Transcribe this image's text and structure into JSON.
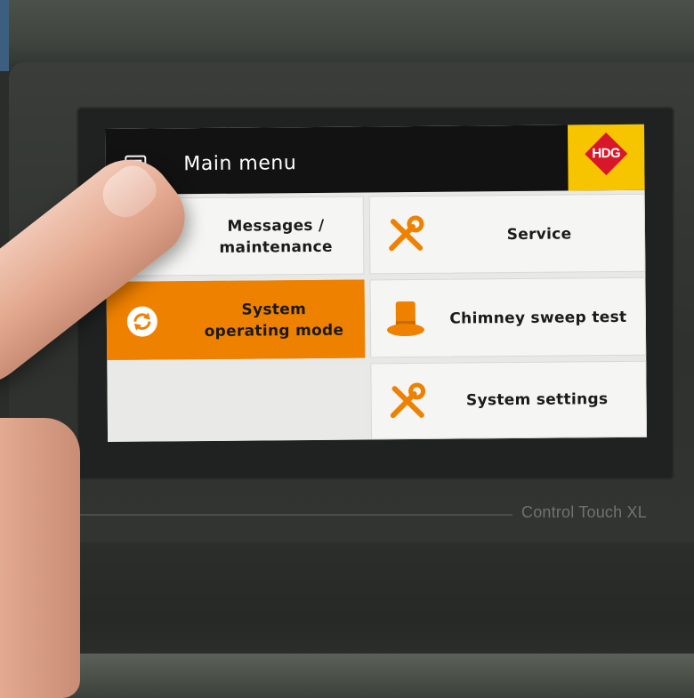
{
  "screen": {
    "title": "Main menu",
    "logo_text": "HDG",
    "tiles": [
      {
        "label_line1": "Messages /",
        "label_line2": "maintenance",
        "icon": "warning-icon",
        "active": false
      },
      {
        "label": "Service",
        "icon": "tools-icon",
        "active": false
      },
      {
        "label_line1": "System",
        "label_line2": "operating mode",
        "icon": "refresh-icon",
        "active": true
      },
      {
        "label": "Chimney sweep test",
        "icon": "top-hat-icon",
        "active": false
      },
      {
        "label": "System settings",
        "icon": "tools-icon",
        "active": false
      }
    ]
  },
  "device": {
    "brand": "Control Touch XL"
  },
  "colors": {
    "accent": "#ef8100",
    "header": "#121212",
    "logo_bg": "#f7c400",
    "logo_red": "#d8182a"
  }
}
